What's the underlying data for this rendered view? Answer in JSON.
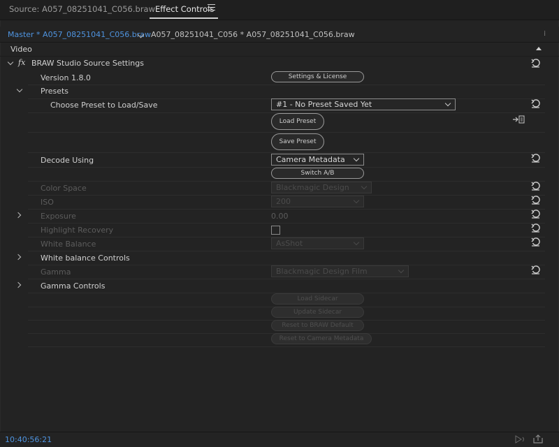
{
  "tabs": {
    "source": "Source: A057_08251041_C056.braw",
    "effect_controls": "Effect Controls"
  },
  "clip": {
    "master": "Master * A057_08251041_C056.braw",
    "sequence": "A057_08251041_C056 * A057_08251041_C056.braw"
  },
  "section": {
    "video": "Video"
  },
  "effect": {
    "fx": "fx",
    "name": "BRAW Studio Source Settings",
    "version": "Version 1.8.0",
    "settings_button": "Settings & License",
    "presets_label": "Presets",
    "choose_preset_label": "Choose Preset to Load/Save",
    "preset_value": "#1 - No Preset Saved Yet",
    "load_preset": "Load Preset",
    "save_preset": "Save Preset",
    "decode_label": "Decode Using",
    "decode_value": "Camera Metadata",
    "switch_ab": "Switch A/B",
    "color_space_label": "Color Space",
    "color_space_value": "Blackmagic Design",
    "iso_label": "ISO",
    "iso_value": "200",
    "exposure_label": "Exposure",
    "exposure_value": "0.00",
    "highlight_label": "Highlight Recovery",
    "white_balance_label": "White Balance",
    "white_balance_value": "AsShot",
    "wb_controls_label": "White balance Controls",
    "gamma_label": "Gamma",
    "gamma_value": "Blackmagic Design Film",
    "gamma_controls_label": "Gamma Controls",
    "load_sidecar": "Load Sidecar",
    "update_sidecar": "Update Sidecar",
    "reset_braw": "Reset to BRAW Default",
    "reset_camera": "Reset to Camera Metadata"
  },
  "footer": {
    "timecode": "10:40:56:21"
  },
  "colors": {
    "accent": "#4f94e0",
    "background": "#232323"
  }
}
